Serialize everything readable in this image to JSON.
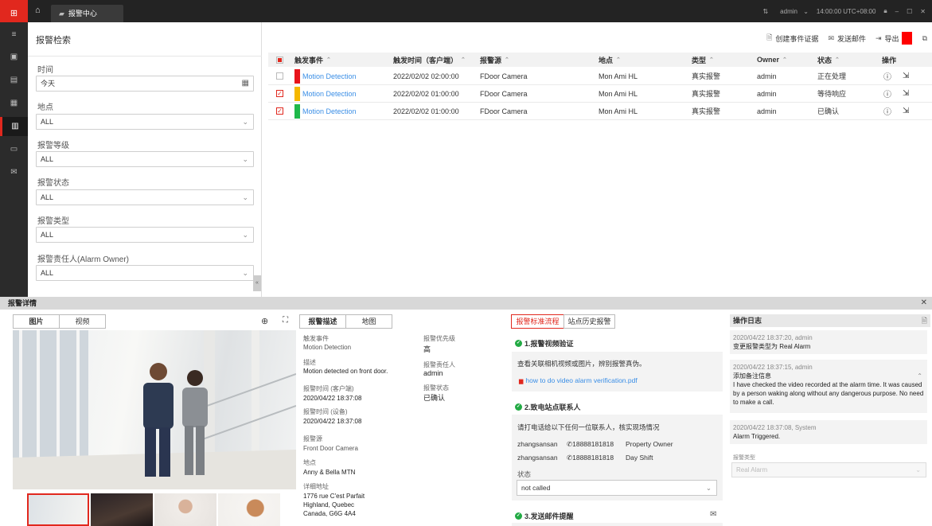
{
  "titlebar": {
    "tab_label": "报警中心",
    "user": "admin",
    "time": "14:00:00 UTC+08:00"
  },
  "filter": {
    "title": "报警检索",
    "fields": [
      {
        "label": "时间",
        "value": "今天"
      },
      {
        "label": "地点",
        "value": "ALL"
      },
      {
        "label": "报警等级",
        "value": "ALL"
      },
      {
        "label": "报警状态",
        "value": "ALL"
      },
      {
        "label": "报警类型",
        "value": "ALL"
      },
      {
        "label": "报警责任人(Alarm Owner)",
        "value": "ALL"
      }
    ]
  },
  "toolbar": {
    "create_evidence": "创建事件证据",
    "send_email": "发送邮件",
    "export": "导出"
  },
  "table": {
    "headers": {
      "event": "触发事件",
      "time": "触发时间（客户端）",
      "source": "报警源",
      "location": "地点",
      "type": "类型",
      "owner": "Owner",
      "status": "状态",
      "actions": "操作"
    },
    "rows": [
      {
        "color": "#e8141b",
        "checked": false,
        "event": "Motion Detection",
        "time": "2022/02/02 02:00:00",
        "source": "FDoor Camera",
        "location": "Mon Ami HL",
        "type": "真实报警",
        "owner": "admin",
        "status": "正在处理"
      },
      {
        "color": "#f5b800",
        "checked": true,
        "event": "Motion Detection",
        "time": "2022/02/02 01:00:00",
        "source": "FDoor Camera",
        "location": "Mon Ami HL",
        "type": "真实报警",
        "owner": "admin",
        "status": "等待响应"
      },
      {
        "color": "#1fb84a",
        "checked": true,
        "event": "Motion Detection",
        "time": "2022/02/02 01:00:00",
        "source": "FDoor Camera",
        "location": "Mon Ami HL",
        "type": "真实报警",
        "owner": "admin",
        "status": "已确认"
      }
    ]
  },
  "detail": {
    "title": "报警详情",
    "media_tabs": {
      "picture": "图片",
      "video": "视频"
    },
    "info_tabs": {
      "description": "报警描述",
      "map": "地图"
    },
    "info": {
      "trigger_event_key": "触发事件",
      "trigger_event": "Motion Detection",
      "desc_key": "描述",
      "desc": "Motion detected on front door.",
      "time_client_key": "报警时间 (客户端)",
      "time_client": "2020/04/22 18:37:08",
      "time_device_key": "报警时间 (设备)",
      "time_device": "2020/04/22 18:37:08",
      "source_key": "报警源",
      "source": "Front Door Camera",
      "location_key": "地点",
      "location": "Anny & Bella MTN",
      "address_key": "详细地址",
      "address_1": "1776 rue C'est Parfait",
      "address_2": "Highland, Quebec",
      "address_3": "Canada, G6G 4A4",
      "priority_key": "报警优先级",
      "priority": "高",
      "owner_key": "报警责任人",
      "owner": "admin",
      "status_key": "报警状态",
      "status": "已确认"
    },
    "sop_tabs": {
      "sop": "报警标准流程",
      "history": "站点历史报警"
    },
    "steps": {
      "s1_title": "1.报警视频验证",
      "s1_text": "查看关联相机视频或图片，辨别报警真伪。",
      "s1_link": "how to do video alarm verification.pdf",
      "s2_title": "2.致电站点联系人",
      "s2_text": "请打电话给以下任何一位联系人，核实现场情况",
      "contacts": [
        {
          "name": "zhangsansan",
          "phone": "18888181818",
          "role": "Property Owner"
        },
        {
          "name": "zhangsansan",
          "phone": "18888181818",
          "role": "Day Shift"
        }
      ],
      "state_label": "状态",
      "state_value": "not called",
      "s3_title": "3.发送邮件提醒"
    },
    "log": {
      "title": "操作日志",
      "entries": [
        {
          "time": "2020/04/22 18:37:20,  admin",
          "text": "变更报警类型为 Real Alarm"
        },
        {
          "time": "2020/04/22 18:37:15,  admin",
          "text": "添加备注信息",
          "note": "I have checked the video recorded at the alarm time.  It was caused by a person waking along without any dangerous purpose. No need to make a call."
        },
        {
          "time": "2020/04/22 18:37:08,  System",
          "text": "Alarm Triggered."
        }
      ],
      "type_label": "报警类型",
      "type_value": "Real Alarm"
    }
  }
}
